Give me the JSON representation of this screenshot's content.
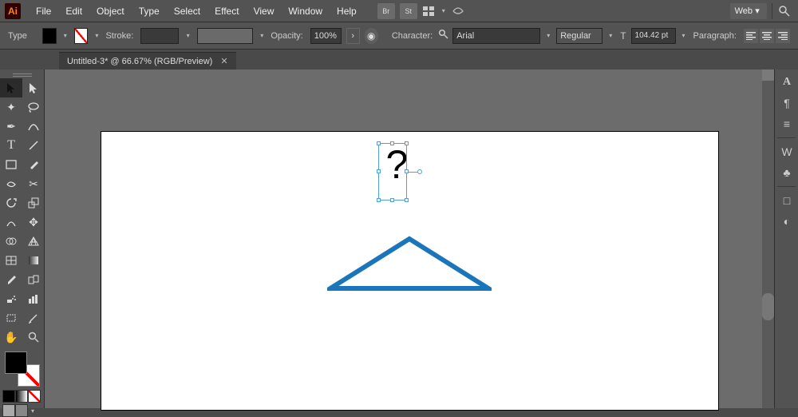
{
  "menu": {
    "items": [
      "File",
      "Edit",
      "Object",
      "Type",
      "Select",
      "Effect",
      "View",
      "Window",
      "Help"
    ],
    "workspace": "Web"
  },
  "control": {
    "mode_label": "Type",
    "stroke_label": "Stroke:",
    "opacity_label": "Opacity:",
    "opacity_value": "100%",
    "character_label": "Character:",
    "font_family": "Arial",
    "font_weight": "Regular",
    "font_size": "104.42 pt",
    "paragraph_label": "Paragraph:"
  },
  "tab": {
    "title": "Untitled-3* @ 66.67% (RGB/Preview)"
  },
  "canvas": {
    "glyph": "?",
    "triangle_color": "#1b75bb"
  },
  "right_icons": [
    "A",
    "¶",
    "≡",
    "W",
    "♣",
    "□",
    "◐"
  ]
}
